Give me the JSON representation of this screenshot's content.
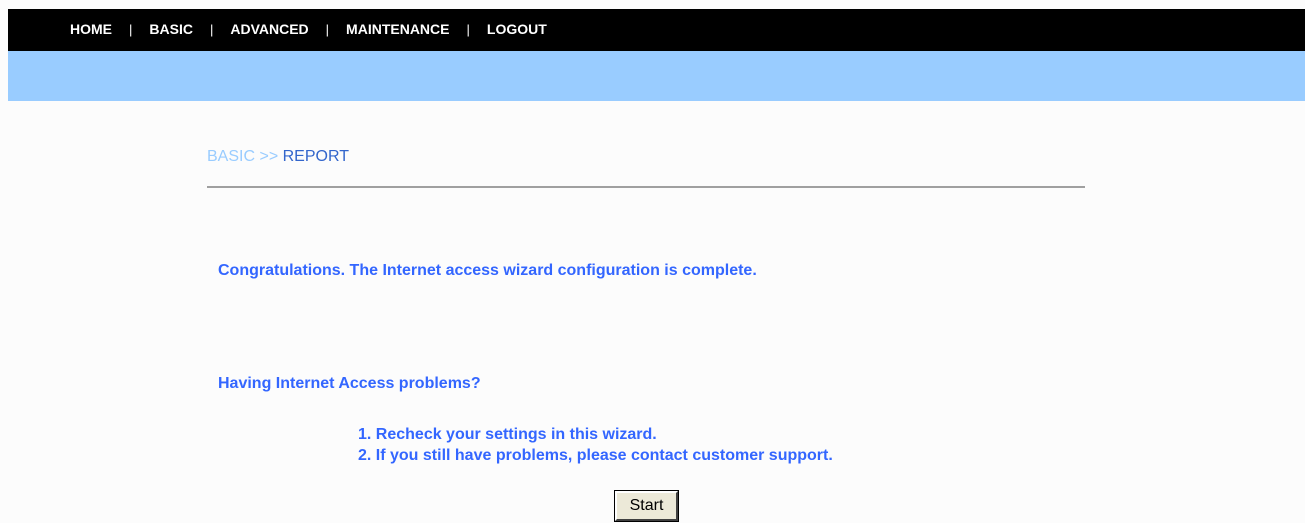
{
  "nav": {
    "items": [
      {
        "label": "HOME"
      },
      {
        "label": "BASIC"
      },
      {
        "label": "ADVANCED"
      },
      {
        "label": "MAINTENANCE"
      },
      {
        "label": "LOGOUT"
      }
    ],
    "separator": "|"
  },
  "breadcrumb": {
    "parent": "BASIC",
    "separator": ">>",
    "current": "REPORT"
  },
  "main": {
    "congrats_text": "Congratulations. The Internet access wizard configuration is complete.",
    "problems_heading": "Having Internet Access problems?",
    "steps": [
      "1. Recheck your settings in this wizard.",
      "2. If you still have problems, please contact customer support."
    ],
    "start_button_label": "Start"
  },
  "colors": {
    "nav_background": "#000000",
    "band_background": "#99ccff",
    "text_blue": "#3366ff",
    "breadcrumb_light": "#99ccff"
  }
}
